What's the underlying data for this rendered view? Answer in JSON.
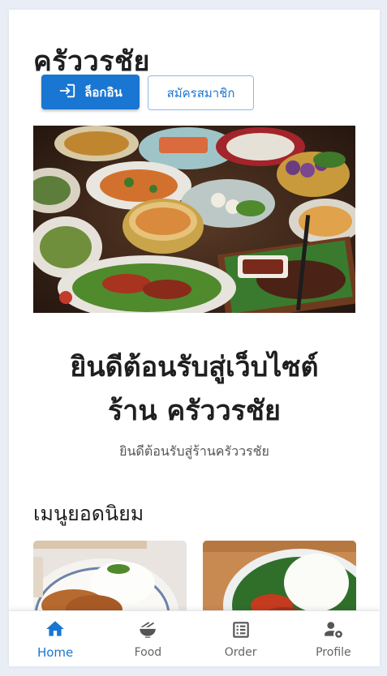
{
  "app": {
    "title": "ครัววรชัย"
  },
  "auth": {
    "login_label": "ล็อกอิน",
    "register_label": "สมัครสมาชิก"
  },
  "hero": {
    "image_icon": "thai-food-spread-image"
  },
  "welcome": {
    "line1": "ยินดีต้อนรับสู่เว็บไซต์",
    "line2": "ร้าน ครัววรชัย",
    "subtitle": "ยินดีต้อนรับสู่ร้านครัววรชัย"
  },
  "popular": {
    "heading": "เมนูยอดนิยม",
    "items": [
      {
        "icon": "pork-rice-dish-image"
      },
      {
        "icon": "crispy-pork-rice-dish-image"
      }
    ]
  },
  "nav": {
    "items": [
      {
        "label": "Home",
        "icon": "home-icon",
        "active": true
      },
      {
        "label": "Food",
        "icon": "food-bowl-icon",
        "active": false
      },
      {
        "label": "Order",
        "icon": "order-list-icon",
        "active": false
      },
      {
        "label": "Profile",
        "icon": "user-settings-icon",
        "active": false
      }
    ]
  },
  "colors": {
    "primary": "#1976d2",
    "background": "#e9edf5",
    "text": "#1f1f1f"
  }
}
